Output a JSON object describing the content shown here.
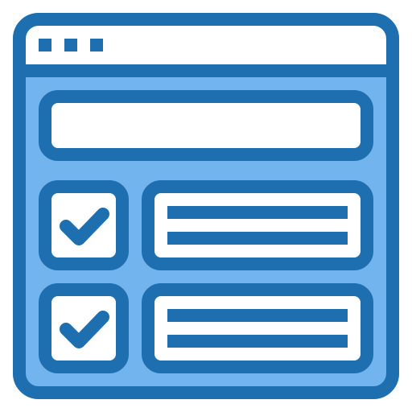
{
  "icon": {
    "name": "checklist-form-window-icon",
    "colors": {
      "stroke": "#1e6fb0",
      "fill_light": "#72b4ed",
      "white": "#ffffff"
    },
    "title_bar": {
      "dots": 3
    },
    "rows": [
      {
        "checked": true,
        "text_lines": 2
      },
      {
        "checked": true,
        "text_lines": 2
      }
    ]
  }
}
